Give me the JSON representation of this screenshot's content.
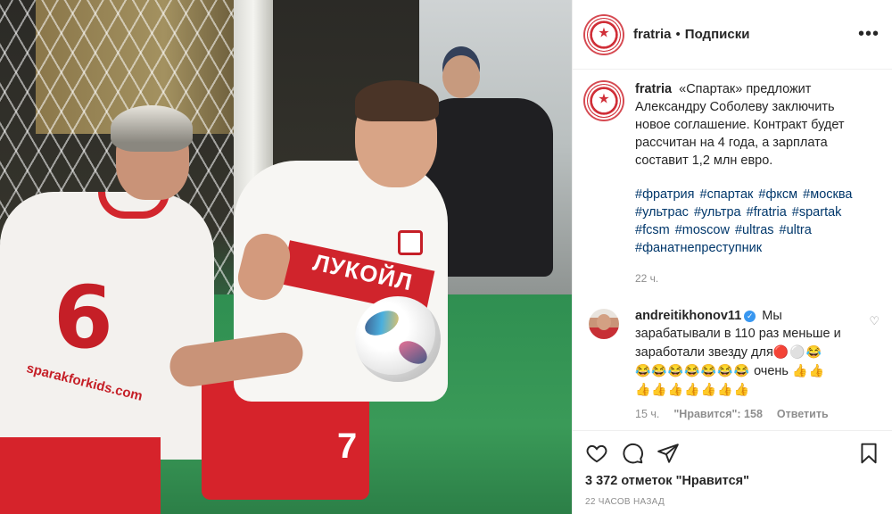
{
  "post": {
    "photo": {
      "player_left_number": "6",
      "player_left_url": "sparakforkids.com",
      "player_right_sponsor": "ЛУКОЙЛ",
      "player_right_number": "7"
    },
    "header": {
      "username": "fratria",
      "separator": "•",
      "follow_label": "Подписки",
      "more_icon": "more-icon",
      "more_label": "•••"
    },
    "caption": {
      "author": "fratria",
      "text": "«Спартак» предложит Александру Соболеву заключить новое соглашение. Контракт будет рассчитан на 4 года, а зарплата составит 1,2 млн евро.",
      "hashtags": [
        "#фратрия",
        "#спартак",
        "#фксм",
        "#москва",
        "#ультрас",
        "#ультра",
        "#fratria",
        "#spartak",
        "#fcsm",
        "#moscow",
        "#ultras",
        "#ultra",
        "#фанатнепреступник"
      ],
      "time": "22 ч."
    },
    "comment": {
      "author": "andreitikhonov11",
      "text": "Мы зарабатывали в 110 раз меньше и заработали звезду для",
      "emoji_inline": "🔴⚪😂",
      "emoji_line2": "😂😂😂😂😂😂😂",
      "text_2": "очень",
      "emoji_thumbs_a": "👍👍",
      "emoji_thumbs_b": "👍👍👍👍👍👍👍",
      "time": "15 ч.",
      "likes": "\"Нравится\": 158",
      "reply": "Ответить"
    },
    "actions": {
      "like_icon": "heart-icon",
      "comment_icon": "comment-icon",
      "share_icon": "share-icon",
      "save_icon": "bookmark-icon"
    },
    "likes_text": "3 372 отметок \"Нравится\"",
    "date_text": "22 ЧАСОВ НАЗАД"
  }
}
